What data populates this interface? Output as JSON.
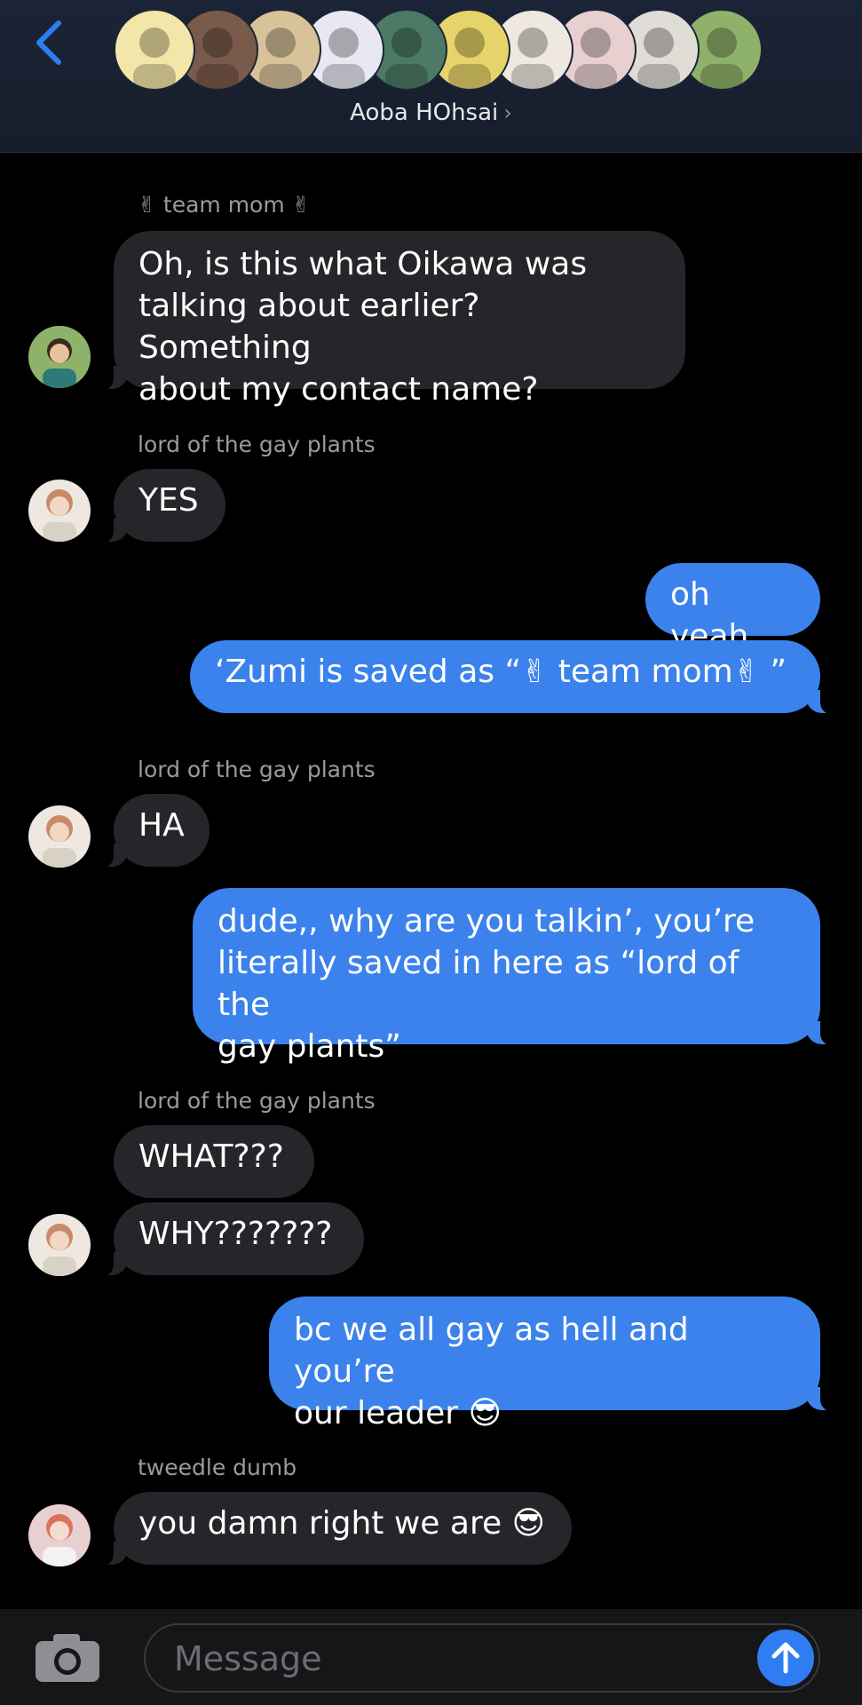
{
  "header": {
    "group_name": "Aoba HOhsai",
    "chevron": "›",
    "avatars": [
      {
        "icon": "moomin-avatar",
        "color": "#f2e6a8"
      },
      {
        "icon": "person-avatar",
        "color": "#7a5a4a"
      },
      {
        "icon": "person-avatar",
        "color": "#d8c29a"
      },
      {
        "icon": "person-avatar",
        "color": "#e8e8f2"
      },
      {
        "icon": "person-avatar",
        "color": "#4c7a66"
      },
      {
        "icon": "person-avatar",
        "color": "#e6d46a"
      },
      {
        "icon": "person-avatar",
        "color": "#efe8e0"
      },
      {
        "icon": "person-avatar",
        "color": "#e8d0d0"
      },
      {
        "icon": "person-avatar",
        "color": "#e0dcd6"
      },
      {
        "icon": "person-avatar",
        "color": "#8fb26a"
      }
    ]
  },
  "messages": [
    {
      "sender": "✌ team mom ✌",
      "text_lines": [
        "Oh, is this what Oikawa was",
        "talking about earlier? Something",
        "about my contact name?"
      ],
      "direction": "incoming"
    },
    {
      "sender": "lord of the gay plants",
      "text": "YES",
      "direction": "incoming"
    },
    {
      "text": "oh yeah",
      "direction": "outgoing"
    },
    {
      "text": "‘Zumi is saved as “✌ team mom✌ ”",
      "direction": "outgoing"
    },
    {
      "sender": "lord of the gay plants",
      "text": "HA",
      "direction": "incoming"
    },
    {
      "text_lines": [
        "dude,, why are you talkin’, you’re",
        "literally saved in here as “lord of the",
        "gay plants”"
      ],
      "direction": "outgoing"
    },
    {
      "sender": "lord of the gay plants",
      "text": "WHAT???",
      "direction": "incoming"
    },
    {
      "text": "WHY???????",
      "direction": "incoming"
    },
    {
      "text_lines": [
        "bc we all gay as hell and you’re",
        "our leader 😎"
      ],
      "direction": "outgoing"
    },
    {
      "sender": "tweedle dumb",
      "text": "you damn right we are 😎",
      "direction": "incoming"
    }
  ],
  "composer": {
    "placeholder": "Message",
    "camera_icon": "camera-icon",
    "send_icon": "arrow-up-icon"
  },
  "colors": {
    "outgoing_bubble": "#3b82ec",
    "incoming_bubble": "#26262a",
    "accent": "#2f7df2"
  }
}
